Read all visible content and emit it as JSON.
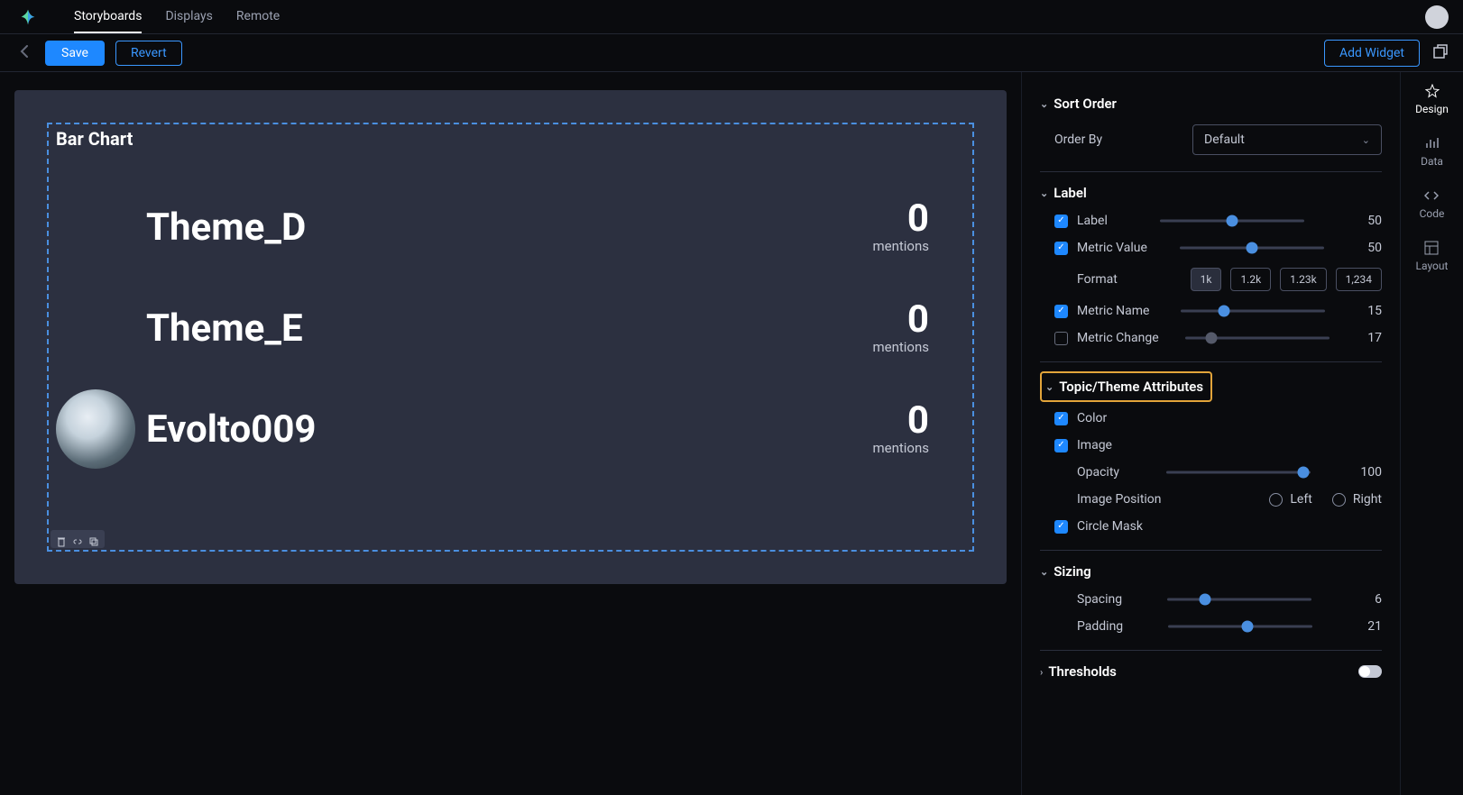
{
  "nav": {
    "links": [
      "Storyboards",
      "Displays",
      "Remote"
    ],
    "active": 0
  },
  "toolbar": {
    "save_label": "Save",
    "revert_label": "Revert",
    "add_widget_label": "Add Widget"
  },
  "widget": {
    "title": "Bar Chart"
  },
  "chart_data": {
    "type": "bar",
    "title": "Bar Chart",
    "metric_unit": "mentions",
    "series": [
      {
        "name": "Theme_D",
        "value": 0,
        "has_image": false
      },
      {
        "name": "Theme_E",
        "value": 0,
        "has_image": false
      },
      {
        "name": "Evolto009",
        "value": 0,
        "has_image": true
      }
    ]
  },
  "rail": {
    "items": [
      "Design",
      "Data",
      "Code",
      "Layout"
    ],
    "active": 0
  },
  "panel": {
    "sort_order": {
      "title": "Sort Order",
      "order_by_label": "Order By",
      "order_by_value": "Default"
    },
    "label": {
      "title": "Label",
      "label_row": {
        "name": "Label",
        "checked": true,
        "value": 50,
        "slider_pct": 50
      },
      "metric_value_row": {
        "name": "Metric Value",
        "checked": true,
        "value": 50,
        "slider_pct": 50
      },
      "format_row": {
        "name": "Format",
        "options": [
          "1k",
          "1.2k",
          "1.23k",
          "1,234"
        ],
        "active": 0
      },
      "metric_name_row": {
        "name": "Metric Name",
        "checked": true,
        "value": 15,
        "slider_pct": 30
      },
      "metric_change_row": {
        "name": "Metric Change",
        "checked": false,
        "value": 17,
        "slider_pct": 18
      }
    },
    "topic_theme": {
      "title": "Topic/Theme Attributes",
      "color_row": {
        "name": "Color",
        "checked": true
      },
      "image_row": {
        "name": "Image",
        "checked": true
      },
      "opacity_row": {
        "name": "Opacity",
        "value": 100,
        "slider_pct": 95
      },
      "image_pos": {
        "name": "Image Position",
        "options": [
          "Left",
          "Right"
        ]
      },
      "circle_mask": {
        "name": "Circle Mask",
        "checked": true
      }
    },
    "sizing": {
      "title": "Sizing",
      "spacing_row": {
        "name": "Spacing",
        "value": 6,
        "slider_pct": 26
      },
      "padding_row": {
        "name": "Padding",
        "value": 21,
        "slider_pct": 55
      }
    },
    "thresholds": {
      "title": "Thresholds"
    }
  }
}
